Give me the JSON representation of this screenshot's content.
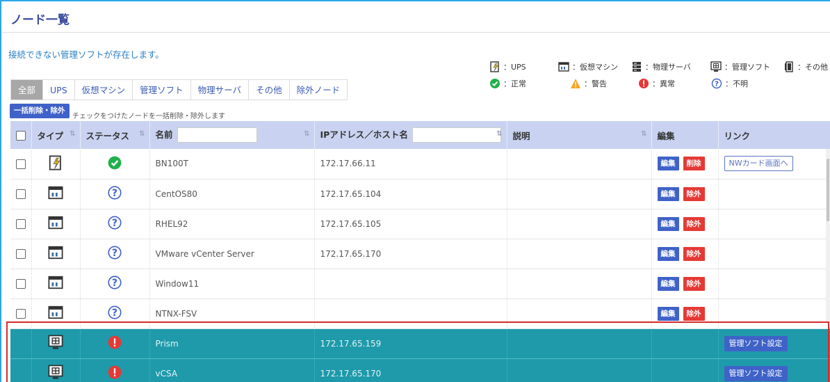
{
  "page": {
    "title": "ノード一覧",
    "warning": "接続できない管理ソフトが存在します。"
  },
  "legend": {
    "types": [
      {
        "icon": "ups-icon",
        "label": "：UPS"
      },
      {
        "icon": "virtual-machine-icon",
        "label": "：仮想マシン"
      },
      {
        "icon": "physical-server-icon",
        "label": "：物理サーバ"
      },
      {
        "icon": "management-software-icon",
        "label": "：管理ソフト"
      },
      {
        "icon": "other-icon",
        "label": "：その他"
      }
    ],
    "statuses": [
      {
        "icon": "ok-check-icon",
        "label": "：正常",
        "color": "#21b04b"
      },
      {
        "icon": "warning-triangle-icon",
        "label": "：警告",
        "color": "#f5a623"
      },
      {
        "icon": "error-exclamation-icon",
        "label": "：異常",
        "color": "#e53935"
      },
      {
        "icon": "unknown-question-icon",
        "label": "：不明",
        "color": "#3f62c8"
      }
    ]
  },
  "tabs": [
    "全部",
    "UPS",
    "仮想マシン",
    "管理ソフト",
    "物理サーバ",
    "その他",
    "除外ノード"
  ],
  "bulk": {
    "button": "一括削除・除外",
    "note": "チェックをつけたノードを一括削除・除外します"
  },
  "table": {
    "headers": {
      "type": "タイプ",
      "status": "ステータス",
      "name": "名前",
      "ip": "IPアドレス／ホスト名",
      "desc": "説明",
      "edit": "編集",
      "link": "リンク"
    },
    "sort_glyph": "⇅",
    "rows": [
      {
        "type": "ups",
        "status": "ok",
        "name": "BN100T",
        "ip": "172.17.66.11",
        "edit": "編集",
        "action": "削除",
        "link": "NWカード画面へ"
      },
      {
        "type": "vm",
        "status": "unknown",
        "name": "CentOS80",
        "ip": "172.17.65.104",
        "edit": "編集",
        "action": "除外",
        "link": ""
      },
      {
        "type": "vm",
        "status": "unknown",
        "name": "RHEL92",
        "ip": "172.17.65.105",
        "edit": "編集",
        "action": "除外",
        "link": ""
      },
      {
        "type": "vm",
        "status": "unknown",
        "name": "VMware vCenter Server",
        "ip": "172.17.65.170",
        "edit": "編集",
        "action": "除外",
        "link": ""
      },
      {
        "type": "vm",
        "status": "unknown",
        "name": "Window11",
        "ip": "",
        "edit": "編集",
        "action": "除外",
        "link": ""
      },
      {
        "type": "vm",
        "status": "unknown",
        "name": "NTNX-FSV",
        "ip": "",
        "edit": "編集",
        "action": "除外",
        "link": ""
      },
      {
        "type": "mgmt",
        "status": "error",
        "name": "Prism",
        "ip": "172.17.65.159",
        "edit": "",
        "action": "",
        "link": "管理ソフト設定",
        "highlight": true
      },
      {
        "type": "mgmt",
        "status": "error",
        "name": "vCSA",
        "ip": "172.17.65.170",
        "edit": "",
        "action": "",
        "link": "管理ソフト設定",
        "highlight": true
      }
    ]
  }
}
